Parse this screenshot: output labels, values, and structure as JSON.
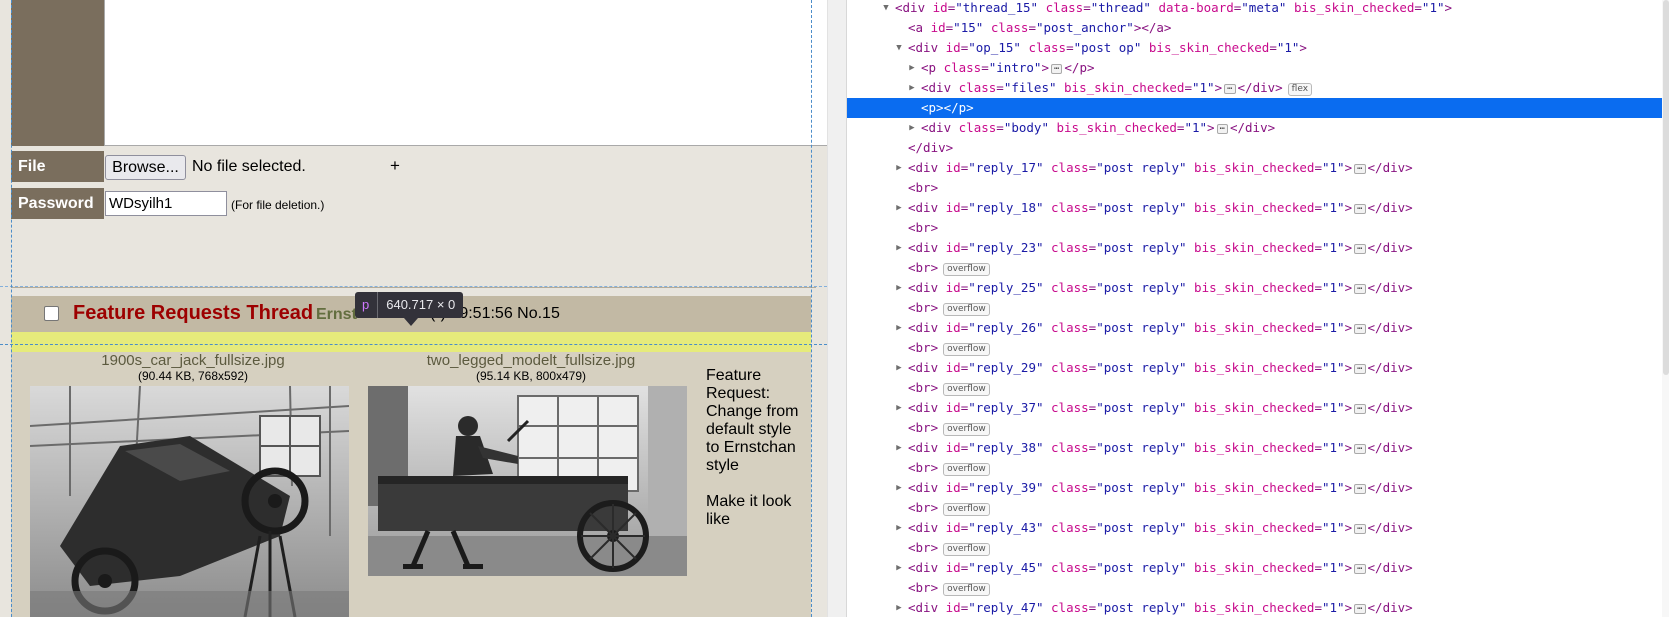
{
  "form": {
    "file_label": "File",
    "browse_label": "Browse...",
    "file_status": "No file selected.",
    "add_file_label": "+",
    "password_label": "Password",
    "password_value": "WDsyilh1",
    "password_note": "(For file deletion.)"
  },
  "thread": {
    "subject": "Feature Requests Thread",
    "name_visible": "Ernst",
    "date_visible": "(-) 19:51:56 No.15",
    "files": [
      {
        "name": "1900s_car_jack_fullsize.jpg",
        "info": "(90.44 KB, 768x592)"
      },
      {
        "name": "two_legged_modelt_fullsize.jpg",
        "info": "(95.14 KB, 800x479)"
      }
    ],
    "body_lines": [
      "Feature Request: Change from default style to Ernstchan style",
      "Make it look like"
    ]
  },
  "inspector_tooltip": {
    "tag": "p",
    "size": "640.717 × 0"
  },
  "devtools": {
    "rows": [
      {
        "indent": 0,
        "twisty": "open",
        "parts": [
          [
            "tag",
            "<div "
          ],
          [
            "attr",
            "id"
          ],
          [
            "tag",
            "="
          ],
          [
            "val",
            "\"thread_15\""
          ],
          [
            "tag",
            " "
          ],
          [
            "attr",
            "class"
          ],
          [
            "tag",
            "="
          ],
          [
            "val",
            "\"thread\""
          ],
          [
            "tag",
            " "
          ],
          [
            "attr",
            "data-board"
          ],
          [
            "tag",
            "="
          ],
          [
            "val",
            "\"meta\""
          ],
          [
            "tag",
            " "
          ],
          [
            "attr",
            "bis_skin_checked"
          ],
          [
            "tag",
            "="
          ],
          [
            "val",
            "\"1\""
          ],
          [
            "tag",
            ">"
          ]
        ]
      },
      {
        "indent": 1,
        "twisty": "",
        "parts": [
          [
            "tag",
            "<a "
          ],
          [
            "attr",
            "id"
          ],
          [
            "tag",
            "="
          ],
          [
            "val",
            "\"15\""
          ],
          [
            "tag",
            " "
          ],
          [
            "attr",
            "class"
          ],
          [
            "tag",
            "="
          ],
          [
            "val",
            "\"post_anchor\""
          ],
          [
            "tag",
            "></a>"
          ]
        ]
      },
      {
        "indent": 1,
        "twisty": "open",
        "parts": [
          [
            "tag",
            "<div "
          ],
          [
            "attr",
            "id"
          ],
          [
            "tag",
            "="
          ],
          [
            "val",
            "\"op_15\""
          ],
          [
            "tag",
            " "
          ],
          [
            "attr",
            "class"
          ],
          [
            "tag",
            "="
          ],
          [
            "val",
            "\"post op\""
          ],
          [
            "tag",
            " "
          ],
          [
            "attr",
            "bis_skin_checked"
          ],
          [
            "tag",
            "="
          ],
          [
            "val",
            "\"1\""
          ],
          [
            "tag",
            ">"
          ]
        ]
      },
      {
        "indent": 2,
        "twisty": "closed",
        "parts": [
          [
            "tag",
            "<p "
          ],
          [
            "attr",
            "class"
          ],
          [
            "tag",
            "="
          ],
          [
            "val",
            "\"intro\""
          ],
          [
            "tag",
            ">"
          ],
          [
            "ell",
            "⋯"
          ],
          [
            "tag",
            "</p>"
          ]
        ]
      },
      {
        "indent": 2,
        "twisty": "closed",
        "badge": "flex",
        "parts": [
          [
            "tag",
            "<div "
          ],
          [
            "attr",
            "class"
          ],
          [
            "tag",
            "="
          ],
          [
            "val",
            "\"files\""
          ],
          [
            "tag",
            " "
          ],
          [
            "attr",
            "bis_skin_checked"
          ],
          [
            "tag",
            "="
          ],
          [
            "val",
            "\"1\""
          ],
          [
            "tag",
            ">"
          ],
          [
            "ell",
            "⋯"
          ],
          [
            "tag",
            "</div>"
          ]
        ]
      },
      {
        "indent": 2,
        "twisty": "",
        "selected": true,
        "parts": [
          [
            "tag",
            "<p></p>"
          ]
        ]
      },
      {
        "indent": 2,
        "twisty": "closed",
        "parts": [
          [
            "tag",
            "<div "
          ],
          [
            "attr",
            "class"
          ],
          [
            "tag",
            "="
          ],
          [
            "val",
            "\"body\""
          ],
          [
            "tag",
            " "
          ],
          [
            "attr",
            "bis_skin_checked"
          ],
          [
            "tag",
            "="
          ],
          [
            "val",
            "\"1\""
          ],
          [
            "tag",
            ">"
          ],
          [
            "ell",
            "⋯"
          ],
          [
            "tag",
            "</div>"
          ]
        ]
      },
      {
        "indent": 1,
        "twisty": "",
        "parts": [
          [
            "tag",
            "</div>"
          ]
        ]
      },
      {
        "indent": 1,
        "twisty": "closed",
        "reply": "17",
        "parts": []
      },
      {
        "indent": 1,
        "twisty": "",
        "parts": [
          [
            "tag",
            "<br>"
          ]
        ]
      },
      {
        "indent": 1,
        "twisty": "closed",
        "reply": "18",
        "parts": []
      },
      {
        "indent": 1,
        "twisty": "",
        "parts": [
          [
            "tag",
            "<br>"
          ]
        ]
      },
      {
        "indent": 1,
        "twisty": "closed",
        "reply": "23",
        "parts": []
      },
      {
        "indent": 1,
        "twisty": "",
        "badge": "overflow",
        "parts": [
          [
            "tag",
            "<br>"
          ]
        ]
      },
      {
        "indent": 1,
        "twisty": "closed",
        "reply": "25",
        "parts": []
      },
      {
        "indent": 1,
        "twisty": "",
        "badge": "overflow",
        "parts": [
          [
            "tag",
            "<br>"
          ]
        ]
      },
      {
        "indent": 1,
        "twisty": "closed",
        "reply": "26",
        "parts": []
      },
      {
        "indent": 1,
        "twisty": "",
        "badge": "overflow",
        "parts": [
          [
            "tag",
            "<br>"
          ]
        ]
      },
      {
        "indent": 1,
        "twisty": "closed",
        "reply": "29",
        "parts": []
      },
      {
        "indent": 1,
        "twisty": "",
        "badge": "overflow",
        "parts": [
          [
            "tag",
            "<br>"
          ]
        ]
      },
      {
        "indent": 1,
        "twisty": "closed",
        "reply": "37",
        "parts": []
      },
      {
        "indent": 1,
        "twisty": "",
        "badge": "overflow",
        "parts": [
          [
            "tag",
            "<br>"
          ]
        ]
      },
      {
        "indent": 1,
        "twisty": "closed",
        "reply": "38",
        "parts": []
      },
      {
        "indent": 1,
        "twisty": "",
        "badge": "overflow",
        "parts": [
          [
            "tag",
            "<br>"
          ]
        ]
      },
      {
        "indent": 1,
        "twisty": "closed",
        "reply": "39",
        "parts": []
      },
      {
        "indent": 1,
        "twisty": "",
        "badge": "overflow",
        "parts": [
          [
            "tag",
            "<br>"
          ]
        ]
      },
      {
        "indent": 1,
        "twisty": "closed",
        "reply": "43",
        "parts": []
      },
      {
        "indent": 1,
        "twisty": "",
        "badge": "overflow",
        "parts": [
          [
            "tag",
            "<br>"
          ]
        ]
      },
      {
        "indent": 1,
        "twisty": "closed",
        "reply": "45",
        "parts": []
      },
      {
        "indent": 1,
        "twisty": "",
        "badge": "overflow",
        "parts": [
          [
            "tag",
            "<br>"
          ]
        ]
      },
      {
        "indent": 1,
        "twisty": "closed",
        "reply": "47",
        "parts": []
      }
    ]
  },
  "colors": {
    "page_bg": "#e8e5de",
    "label_bg": "#7a6e5d",
    "subject": "#9d0000",
    "name": "#636e3f",
    "inspector_highlight": "#e9f06e",
    "devtools_selection": "#0a6cf0"
  },
  "icons": {
    "expanded": "triangle-down-icon",
    "collapsed": "triangle-right-icon",
    "ellipsis": "ellipsis-icon"
  }
}
